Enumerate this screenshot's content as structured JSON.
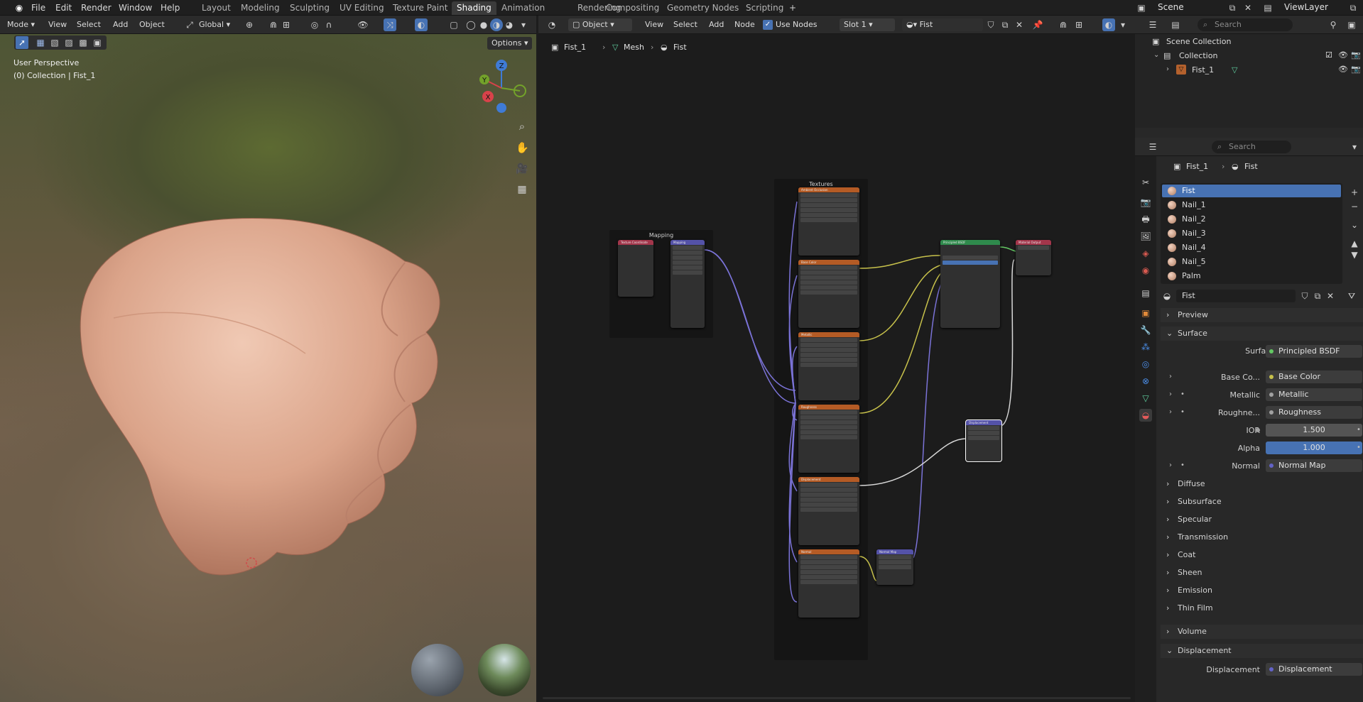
{
  "topbar": {
    "menu": [
      "File",
      "Edit",
      "Render",
      "Window",
      "Help"
    ],
    "workspaces": [
      "Layout",
      "Modeling",
      "Sculpting",
      "UV Editing",
      "Texture Paint",
      "Shading",
      "Animation",
      "Rendering",
      "Compositing",
      "Geometry Nodes",
      "Scripting"
    ],
    "active_workspace": "Shading",
    "scene": "Scene",
    "view_layer": "ViewLayer"
  },
  "viewport": {
    "mode": "Mode",
    "menus": [
      "View",
      "Select",
      "Add",
      "Object"
    ],
    "transform_orientation": "Global",
    "options_label": "Options",
    "view_name": "User Perspective",
    "collection_info": "(0) Collection | Fist_1",
    "gizmo": {
      "x": "X",
      "y": "Y",
      "z": "Z"
    }
  },
  "node_editor": {
    "object_mode": "Object",
    "menus": [
      "View",
      "Select",
      "Add",
      "Node"
    ],
    "use_nodes_label": "Use Nodes",
    "slot": "Slot 1",
    "material": "Fist",
    "breadcrumb": [
      "Fist_1",
      "Mesh",
      "Fist"
    ],
    "frames": {
      "mapping": "Mapping",
      "textures": "Textures"
    },
    "nodes": {
      "tex_coord": "Texture Coordinate",
      "mapping": "Mapping",
      "principled": "Principled BSDF",
      "output": "Material Output",
      "displacement": "Displacement",
      "normal_map": "Normal Map",
      "tex_ao": "Ambient Occlusion",
      "tex_base": "Base Color",
      "tex_metal": "Metallic",
      "tex_rough": "Roughness",
      "tex_disp": "Displacement",
      "tex_normal": "Normal"
    }
  },
  "outliner": {
    "search_placeholder": "Search",
    "scene_collection": "Scene Collection",
    "collection": "Collection",
    "object": "Fist_1"
  },
  "properties": {
    "search_placeholder": "Search",
    "breadcrumb": [
      "Fist_1",
      "Fist"
    ],
    "materials": [
      "Fist",
      "Nail_1",
      "Nail_2",
      "Nail_3",
      "Nail_4",
      "Nail_5",
      "Palm"
    ],
    "active_material": "Fist",
    "material_name": "Fist",
    "panels": {
      "preview": "Preview",
      "surface": "Surface",
      "volume": "Volume",
      "displacement": "Displacement"
    },
    "surface": {
      "surface_label": "Surface",
      "surface_value": "Principled BSDF",
      "base_color_label": "Base Co...",
      "base_color_value": "Base Color",
      "metallic_label": "Metallic",
      "metallic_value": "Metallic",
      "roughness_label": "Roughne...",
      "roughness_value": "Roughness",
      "ior_label": "IOR",
      "ior_value": "1.500",
      "alpha_label": "Alpha",
      "alpha_value": "1.000",
      "normal_label": "Normal",
      "normal_value": "Normal Map"
    },
    "subpanels": [
      "Diffuse",
      "Subsurface",
      "Specular",
      "Transmission",
      "Coat",
      "Sheen",
      "Emission",
      "Thin Film"
    ],
    "displacement": {
      "label": "Displacement",
      "value": "Displacement"
    },
    "colors": {
      "accent": "#4772b3",
      "shader_green": "#63c763",
      "vector_purple": "#6363c7",
      "float_gray": "#a1a1a1"
    }
  }
}
